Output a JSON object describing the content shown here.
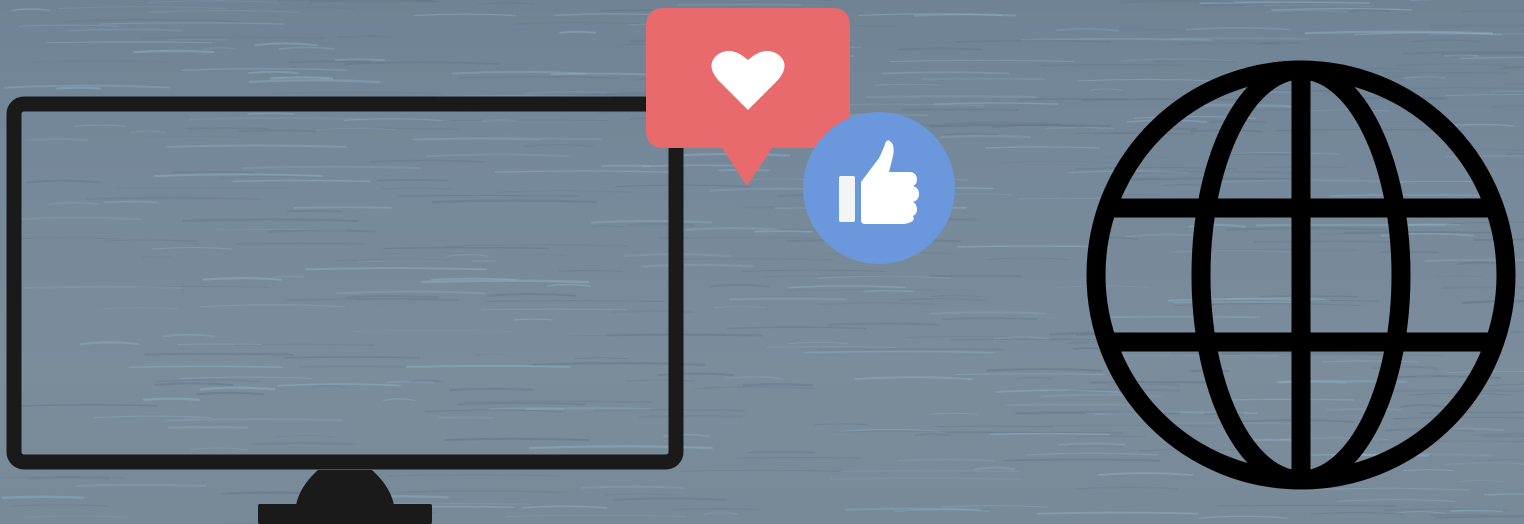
{
  "scene": {
    "background": "water-texture",
    "colors": {
      "water_base": "#76899a",
      "ripple_light": "#93b3c6",
      "ripple_dark": "#5f7384",
      "outline": "#1a1a1a",
      "heart_bubble": "#e86a6c",
      "like_circle": "#6b97dc",
      "icon_white": "#ffffff"
    },
    "icons": [
      "monitor-icon",
      "heart-notification-icon",
      "thumbs-up-icon",
      "globe-icon"
    ]
  }
}
